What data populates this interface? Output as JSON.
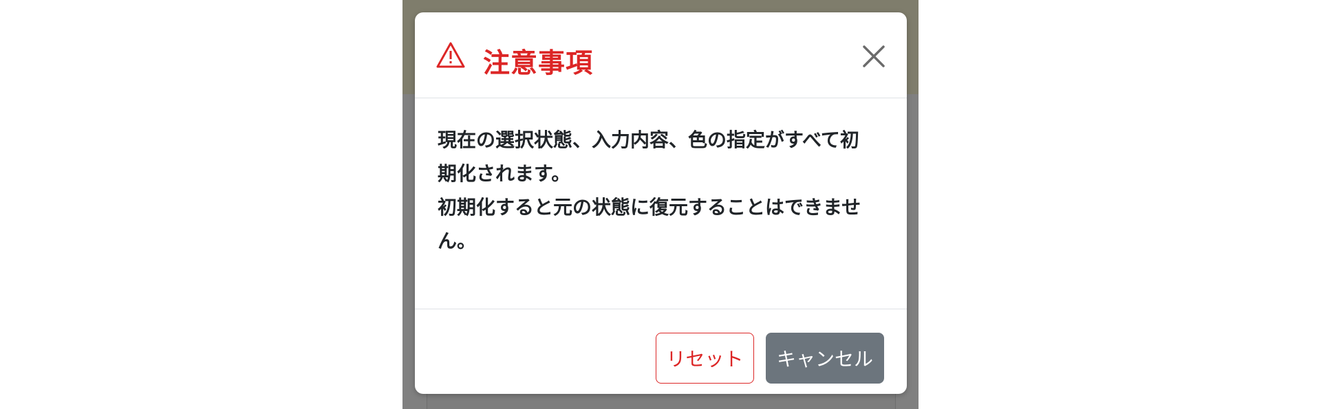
{
  "modal": {
    "title": "注意事項",
    "icon": "warning-icon",
    "close_icon": "close-icon",
    "message": "現在の選択状態、入力内容、色の指定がすべて初\n期化されます。\n初期化すると元の状態に復元することはできませ\nん。",
    "buttons": {
      "reset_label": "リセット",
      "cancel_label": "キャンセル"
    }
  },
  "colors": {
    "accent_danger": "#dc2626",
    "secondary": "#6c757d",
    "overlay": "#808080",
    "header_band": "#7f7d6c"
  }
}
